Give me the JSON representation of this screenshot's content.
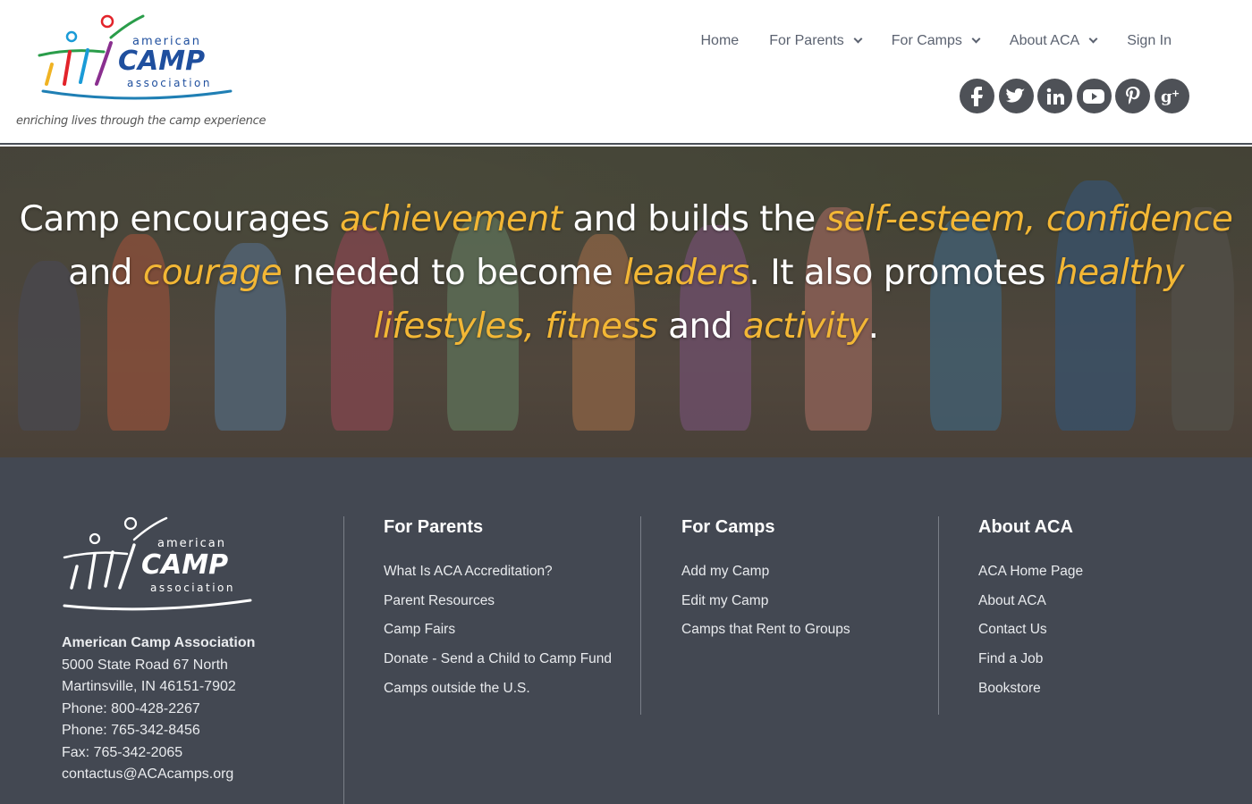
{
  "header": {
    "logo_text": {
      "top": "american",
      "main": "CAMP",
      "bottom": "association"
    },
    "tagline": "enriching lives through the camp experience",
    "nav": [
      {
        "label": "Home",
        "dropdown": false
      },
      {
        "label": "For Parents",
        "dropdown": true
      },
      {
        "label": "For Camps",
        "dropdown": true
      },
      {
        "label": "About ACA",
        "dropdown": true
      },
      {
        "label": "Sign In",
        "dropdown": false
      }
    ],
    "social": [
      "facebook-icon",
      "twitter-icon",
      "linkedin-icon",
      "youtube-icon",
      "pinterest-icon",
      "google-plus-icon"
    ]
  },
  "hero": {
    "segments": [
      {
        "t": "Camp encourages ",
        "hl": false
      },
      {
        "t": "achievement",
        "hl": true
      },
      {
        "t": " and builds the ",
        "hl": false
      },
      {
        "t": "self-esteem, confidence",
        "hl": true
      },
      {
        "t": " and ",
        "hl": false
      },
      {
        "t": "courage",
        "hl": true
      },
      {
        "t": " needed to become ",
        "hl": false
      },
      {
        "t": "leaders",
        "hl": true
      },
      {
        "t": ". It also promotes ",
        "hl": false
      },
      {
        "t": "healthy lifestyles, fitness",
        "hl": true
      },
      {
        "t": " and ",
        "hl": false
      },
      {
        "t": "activity",
        "hl": true
      },
      {
        "t": ".",
        "hl": false
      }
    ]
  },
  "footer": {
    "org": {
      "name": "American Camp Association",
      "address1": "5000 State Road 67 North",
      "address2": "Martinsville, IN 46151-7902",
      "phone1": "Phone: 800-428-2267",
      "phone2": "Phone: 765-342-8456",
      "fax": "Fax: 765-342-2065",
      "email": "contactus@ACAcamps.org"
    },
    "columns": [
      {
        "title": "For Parents",
        "links": [
          "What Is ACA Accreditation?",
          "Parent Resources",
          "Camp Fairs",
          "Donate - Send a Child to Camp Fund",
          "Camps outside the U.S."
        ]
      },
      {
        "title": "For Camps",
        "links": [
          "Add my Camp",
          "Edit my Camp",
          "Camps that Rent to Groups"
        ]
      },
      {
        "title": "About ACA",
        "links": [
          "ACA Home Page",
          "About ACA",
          "Contact Us",
          "Find a Job",
          "Bookstore"
        ]
      }
    ]
  },
  "colors": {
    "accent": "#f3b735",
    "footer_bg": "#434852",
    "nav_text": "#5b6270",
    "social_bg": "#4e5157"
  }
}
